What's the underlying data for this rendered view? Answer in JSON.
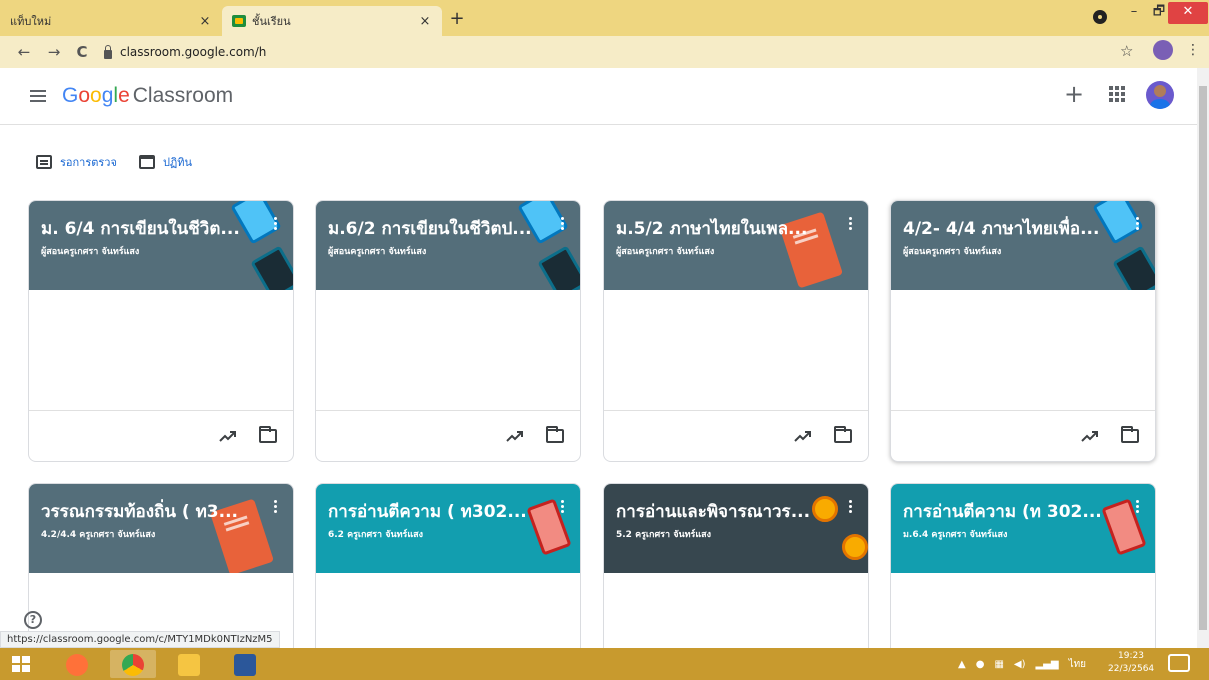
{
  "browser": {
    "tabs": [
      {
        "title": "แท็บใหม่",
        "close": "×"
      },
      {
        "title": "ชั้นเรียน",
        "close": "×"
      }
    ],
    "new_tab": "+",
    "window_controls": {
      "minimize": "–",
      "restore": "🗗",
      "close": "✕"
    },
    "nav": {
      "back": "←",
      "forward": "→",
      "reload": "C"
    },
    "url": "classroom.google.com/h",
    "star": "☆",
    "menu": "⋮"
  },
  "app": {
    "logo": {
      "google": [
        "G",
        "o",
        "o",
        "g",
        "l",
        "e"
      ],
      "product": "Classroom"
    },
    "add": "+",
    "quick_links": [
      {
        "label": "รอการตรวจ",
        "icon": "todo-icon"
      },
      {
        "label": "ปฏิทิน",
        "icon": "calendar-icon"
      }
    ]
  },
  "cards": [
    {
      "title": "ม. 6/4 การเขียนในชีวิต...",
      "subtitle": "ผู้สอนครูเกศรา จันทร์แสง",
      "theme": "slate"
    },
    {
      "title": "ม.6/2 การเขียนในชีวิตป...",
      "subtitle": "ผู้สอนครูเกศรา จันทร์แสง",
      "theme": "slate"
    },
    {
      "title": "ม.5/2 ภาษาไทยในเพล...",
      "subtitle": "ผู้สอนครูเกศรา จันทร์แสง",
      "theme": "slate"
    },
    {
      "title": "4/2- 4/4 ภาษาไทยเพื่อ...",
      "subtitle": "ผู้สอนครูเกศรา จันทร์แสง",
      "theme": "slate"
    },
    {
      "title": "วรรณกรรมท้องถิ่น ( ท3...",
      "subtitle": "4.2/4.4 ครูเกศรา จันทร์แสง",
      "theme": "slate"
    },
    {
      "title": "การอ่านตีความ ( ท302...",
      "subtitle": "6.2 ครูเกศรา จันทร์แสง",
      "theme": "teal"
    },
    {
      "title": "การอ่านและพิจารณาวร...",
      "subtitle": "5.2 ครูเกศรา จันทร์แสง",
      "theme": "dark"
    },
    {
      "title": "การอ่านตีความ (ท 302...",
      "subtitle": "ม.6.4 ครูเกศรา จันทร์แสง",
      "theme": "teal"
    }
  ],
  "help": "?",
  "status_url": "https://classroom.google.com/c/MTY1MDk0NTIzNzM5",
  "taskbar": {
    "apps": [
      "firefox-icon",
      "chrome-icon",
      "file-explorer-icon",
      "word-icon"
    ],
    "tray": {
      "lang": "ไทย"
    },
    "clock": {
      "time": "19:23",
      "date": "22/3/2564"
    }
  },
  "colors": {
    "slate": "#546e7a",
    "teal": "#129eaf",
    "dark": "#37474f",
    "taskbar": "#c89a2e",
    "chrome": "#eed680"
  }
}
